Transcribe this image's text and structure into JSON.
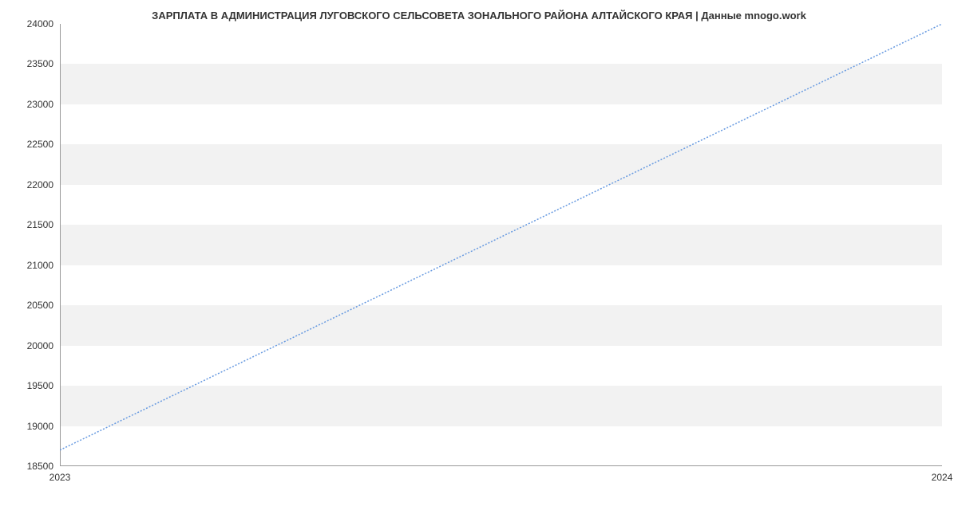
{
  "chart_data": {
    "type": "line",
    "title": "ЗАРПЛАТА В АДМИНИСТРАЦИЯ ЛУГОВСКОГО СЕЛЬСОВЕТА ЗОНАЛЬНОГО РАЙОНА АЛТАЙСКОГО КРАЯ | Данные mnogo.work",
    "x": [
      2023,
      2024
    ],
    "values": [
      18700,
      24000
    ],
    "y_ticks": [
      18500,
      19000,
      19500,
      20000,
      20500,
      21000,
      21500,
      22000,
      22500,
      23000,
      23500,
      24000
    ],
    "x_ticks": [
      "2023",
      "2024"
    ],
    "ylim": [
      18500,
      24000
    ],
    "xlim": [
      2023,
      2024
    ],
    "line_color": "#6699e0",
    "band_color": "#f2f2f2",
    "xlabel": "",
    "ylabel": ""
  }
}
